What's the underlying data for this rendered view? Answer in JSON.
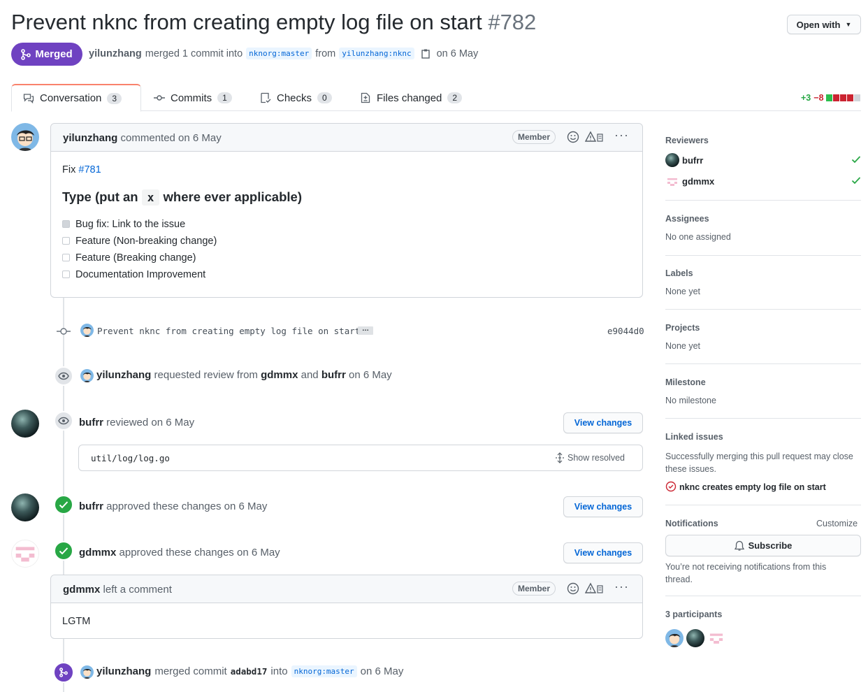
{
  "header": {
    "title": "Prevent nknc from creating empty log file on start",
    "number": "#782",
    "open_with": "Open with",
    "state": "Merged",
    "author": "yilunzhang",
    "merged_text": "merged 1 commit into",
    "base_branch": "nknorg:master",
    "from": "from",
    "head_branch": "yilunzhang:nknc",
    "date": "on 6 May"
  },
  "tabs": [
    {
      "label": "Conversation",
      "count": "3"
    },
    {
      "label": "Commits",
      "count": "1"
    },
    {
      "label": "Checks",
      "count": "0"
    },
    {
      "label": "Files changed",
      "count": "2"
    }
  ],
  "diffstat": {
    "add": "+3",
    "del": "−8"
  },
  "comment1": {
    "author": "yilunzhang",
    "meta": "commented on 6 May",
    "badge": "Member",
    "fix_label": "Fix",
    "fix_link": "#781",
    "heading_pre": "Type (put an",
    "heading_code": "x",
    "heading_post": "where ever applicable)",
    "items": [
      {
        "label": "Bug fix: Link to the issue",
        "checked": true
      },
      {
        "label": "Feature (Non-breaking change)",
        "checked": false
      },
      {
        "label": "Feature (Breaking change)",
        "checked": false
      },
      {
        "label": "Documentation Improvement",
        "checked": false
      }
    ]
  },
  "commit": {
    "message": "Prevent nknc from creating empty log file on start",
    "more": "…",
    "sha": "e9044d0"
  },
  "review_request": {
    "author": "yilunzhang",
    "text1": "requested review from",
    "r1": "gdmmx",
    "and": "and",
    "r2": "bufrr",
    "date": "on 6 May"
  },
  "review1": {
    "author": "bufrr",
    "text": "reviewed on 6 May",
    "view": "View changes",
    "file": "util/log/log.go",
    "show_resolved": "Show resolved"
  },
  "approve1": {
    "author": "bufrr",
    "text": "approved these changes on 6 May",
    "view": "View changes"
  },
  "approve2": {
    "author": "gdmmx",
    "text": "approved these changes on 6 May",
    "view": "View changes"
  },
  "comment2": {
    "author": "gdmmx",
    "meta": "left a comment",
    "badge": "Member",
    "body": "LGTM"
  },
  "merge_event": {
    "author": "yilunzhang",
    "text": "merged commit",
    "sha": "adabd17",
    "into": "into",
    "branch": "nknorg:master",
    "date": "on 6 May"
  },
  "sidebar": {
    "reviewers_h": "Reviewers",
    "reviewers": [
      "bufrr",
      "gdmmx"
    ],
    "assignees_h": "Assignees",
    "assignees": "No one assigned",
    "labels_h": "Labels",
    "labels": "None yet",
    "projects_h": "Projects",
    "projects": "None yet",
    "milestone_h": "Milestone",
    "milestone": "No milestone",
    "linked_h": "Linked issues",
    "linked_text": "Successfully merging this pull request may close these issues.",
    "linked_issue": "nknc creates empty log file on start",
    "notif_h": "Notifications",
    "customize": "Customize",
    "subscribe": "Subscribe",
    "notif_text": "You’re not receiving notifications from this thread.",
    "participants": "3 participants"
  },
  "colors": {
    "merged": "#6f42c1",
    "green": "#28a745",
    "red": "#cb2431",
    "link": "#0366d6"
  }
}
